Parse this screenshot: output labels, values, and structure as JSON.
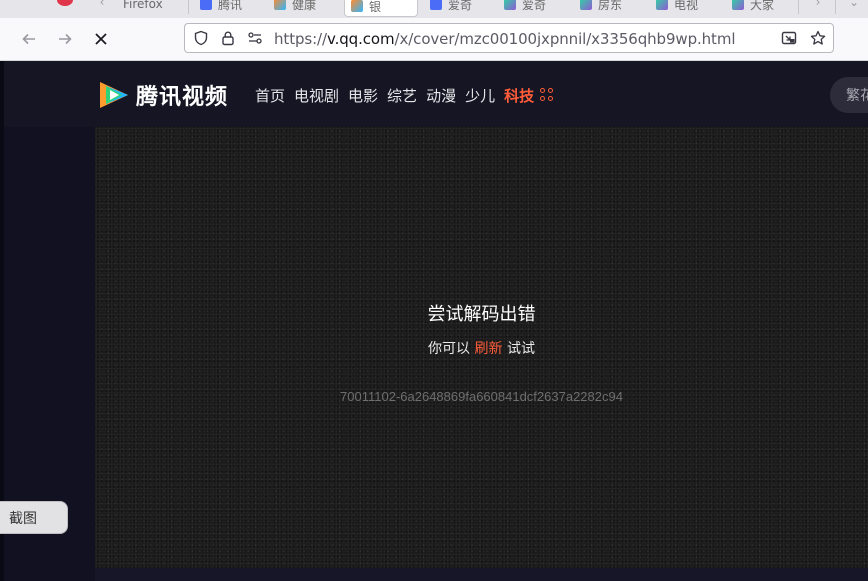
{
  "browser": {
    "tabs": [
      {
        "label": "Firefox",
        "color": "#ff7139"
      },
      {
        "label": "腾讯",
        "color": "#4a6cf7"
      },
      {
        "label": "健康",
        "color": "#2fb6ff"
      },
      {
        "label": "银",
        "color": "#2fb6ff"
      },
      {
        "label": "爱奇",
        "color": "#4a6cf7"
      },
      {
        "label": "爱奇",
        "color": "#8f5bd6"
      },
      {
        "label": "房东",
        "color": "#8f5bd6"
      },
      {
        "label": "电视",
        "color": "#8f5bd6"
      },
      {
        "label": "大家",
        "color": "#8f5bd6"
      }
    ],
    "url": {
      "scheme": "https://",
      "host": "v.qq.com",
      "path": "/x/cover/mzc00100jxpnnil/x3356qhb9wp.html"
    }
  },
  "site": {
    "logo_text": "腾讯视频",
    "nav": [
      "首页",
      "电视剧",
      "电影",
      "综艺",
      "动漫",
      "少儿"
    ],
    "nav_active": "科技",
    "search_placeholder": "繁花",
    "accent": "#ff5c38"
  },
  "player": {
    "error_title": "尝试解码出错",
    "error_prefix": "你可以 ",
    "error_link": "刷新",
    "error_suffix": " 试试",
    "error_code": "70011102-6a2648869fa660841dcf2637a2282c94"
  },
  "overlay": {
    "screenshot_label": "截图"
  }
}
